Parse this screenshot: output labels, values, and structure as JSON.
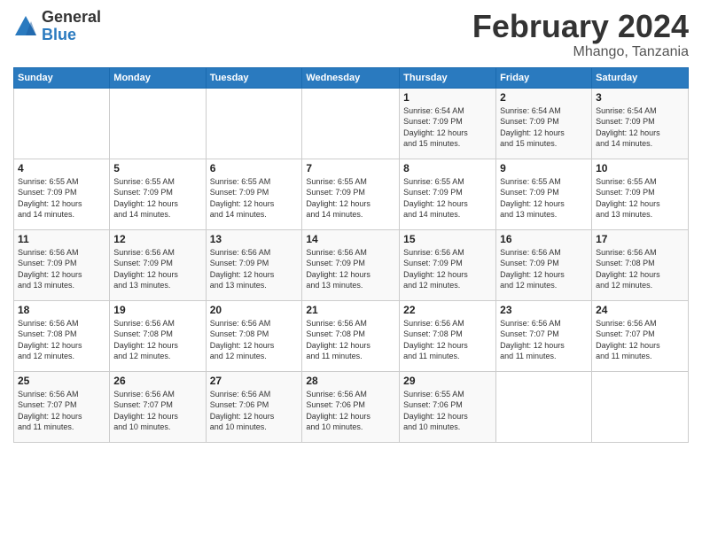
{
  "logo": {
    "general": "General",
    "blue": "Blue"
  },
  "title": "February 2024",
  "subtitle": "Mhango, Tanzania",
  "days_of_week": [
    "Sunday",
    "Monday",
    "Tuesday",
    "Wednesday",
    "Thursday",
    "Friday",
    "Saturday"
  ],
  "weeks": [
    [
      {
        "day": "",
        "info": ""
      },
      {
        "day": "",
        "info": ""
      },
      {
        "day": "",
        "info": ""
      },
      {
        "day": "",
        "info": ""
      },
      {
        "day": "1",
        "info": "Sunrise: 6:54 AM\nSunset: 7:09 PM\nDaylight: 12 hours\nand 15 minutes."
      },
      {
        "day": "2",
        "info": "Sunrise: 6:54 AM\nSunset: 7:09 PM\nDaylight: 12 hours\nand 15 minutes."
      },
      {
        "day": "3",
        "info": "Sunrise: 6:54 AM\nSunset: 7:09 PM\nDaylight: 12 hours\nand 14 minutes."
      }
    ],
    [
      {
        "day": "4",
        "info": "Sunrise: 6:55 AM\nSunset: 7:09 PM\nDaylight: 12 hours\nand 14 minutes."
      },
      {
        "day": "5",
        "info": "Sunrise: 6:55 AM\nSunset: 7:09 PM\nDaylight: 12 hours\nand 14 minutes."
      },
      {
        "day": "6",
        "info": "Sunrise: 6:55 AM\nSunset: 7:09 PM\nDaylight: 12 hours\nand 14 minutes."
      },
      {
        "day": "7",
        "info": "Sunrise: 6:55 AM\nSunset: 7:09 PM\nDaylight: 12 hours\nand 14 minutes."
      },
      {
        "day": "8",
        "info": "Sunrise: 6:55 AM\nSunset: 7:09 PM\nDaylight: 12 hours\nand 14 minutes."
      },
      {
        "day": "9",
        "info": "Sunrise: 6:55 AM\nSunset: 7:09 PM\nDaylight: 12 hours\nand 13 minutes."
      },
      {
        "day": "10",
        "info": "Sunrise: 6:55 AM\nSunset: 7:09 PM\nDaylight: 12 hours\nand 13 minutes."
      }
    ],
    [
      {
        "day": "11",
        "info": "Sunrise: 6:56 AM\nSunset: 7:09 PM\nDaylight: 12 hours\nand 13 minutes."
      },
      {
        "day": "12",
        "info": "Sunrise: 6:56 AM\nSunset: 7:09 PM\nDaylight: 12 hours\nand 13 minutes."
      },
      {
        "day": "13",
        "info": "Sunrise: 6:56 AM\nSunset: 7:09 PM\nDaylight: 12 hours\nand 13 minutes."
      },
      {
        "day": "14",
        "info": "Sunrise: 6:56 AM\nSunset: 7:09 PM\nDaylight: 12 hours\nand 13 minutes."
      },
      {
        "day": "15",
        "info": "Sunrise: 6:56 AM\nSunset: 7:09 PM\nDaylight: 12 hours\nand 12 minutes."
      },
      {
        "day": "16",
        "info": "Sunrise: 6:56 AM\nSunset: 7:09 PM\nDaylight: 12 hours\nand 12 minutes."
      },
      {
        "day": "17",
        "info": "Sunrise: 6:56 AM\nSunset: 7:08 PM\nDaylight: 12 hours\nand 12 minutes."
      }
    ],
    [
      {
        "day": "18",
        "info": "Sunrise: 6:56 AM\nSunset: 7:08 PM\nDaylight: 12 hours\nand 12 minutes."
      },
      {
        "day": "19",
        "info": "Sunrise: 6:56 AM\nSunset: 7:08 PM\nDaylight: 12 hours\nand 12 minutes."
      },
      {
        "day": "20",
        "info": "Sunrise: 6:56 AM\nSunset: 7:08 PM\nDaylight: 12 hours\nand 12 minutes."
      },
      {
        "day": "21",
        "info": "Sunrise: 6:56 AM\nSunset: 7:08 PM\nDaylight: 12 hours\nand 11 minutes."
      },
      {
        "day": "22",
        "info": "Sunrise: 6:56 AM\nSunset: 7:08 PM\nDaylight: 12 hours\nand 11 minutes."
      },
      {
        "day": "23",
        "info": "Sunrise: 6:56 AM\nSunset: 7:07 PM\nDaylight: 12 hours\nand 11 minutes."
      },
      {
        "day": "24",
        "info": "Sunrise: 6:56 AM\nSunset: 7:07 PM\nDaylight: 12 hours\nand 11 minutes."
      }
    ],
    [
      {
        "day": "25",
        "info": "Sunrise: 6:56 AM\nSunset: 7:07 PM\nDaylight: 12 hours\nand 11 minutes."
      },
      {
        "day": "26",
        "info": "Sunrise: 6:56 AM\nSunset: 7:07 PM\nDaylight: 12 hours\nand 10 minutes."
      },
      {
        "day": "27",
        "info": "Sunrise: 6:56 AM\nSunset: 7:06 PM\nDaylight: 12 hours\nand 10 minutes."
      },
      {
        "day": "28",
        "info": "Sunrise: 6:56 AM\nSunset: 7:06 PM\nDaylight: 12 hours\nand 10 minutes."
      },
      {
        "day": "29",
        "info": "Sunrise: 6:55 AM\nSunset: 7:06 PM\nDaylight: 12 hours\nand 10 minutes."
      },
      {
        "day": "",
        "info": ""
      },
      {
        "day": "",
        "info": ""
      }
    ]
  ]
}
